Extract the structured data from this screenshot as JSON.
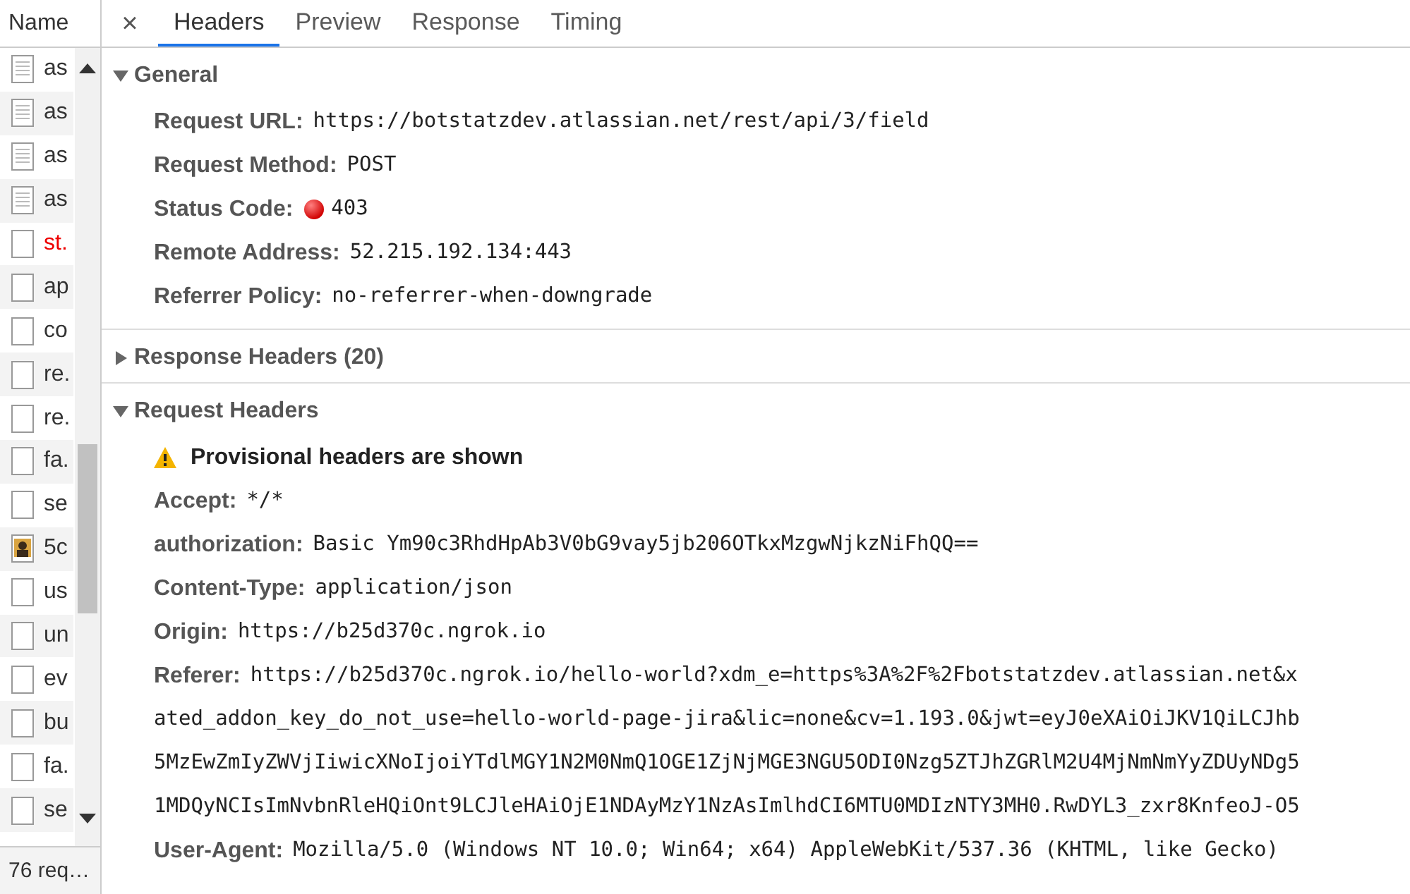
{
  "sidebar": {
    "header": "Name",
    "items": [
      {
        "name": "as",
        "kind": "document",
        "error": false
      },
      {
        "name": "as",
        "kind": "document",
        "error": false
      },
      {
        "name": "as",
        "kind": "document",
        "error": false
      },
      {
        "name": "as",
        "kind": "document",
        "error": false
      },
      {
        "name": "st.",
        "kind": "blank",
        "error": true
      },
      {
        "name": "ap",
        "kind": "blank",
        "error": false
      },
      {
        "name": "co",
        "kind": "blank",
        "error": false
      },
      {
        "name": "re.",
        "kind": "blank",
        "error": false
      },
      {
        "name": "re.",
        "kind": "blank",
        "error": false
      },
      {
        "name": "fa.",
        "kind": "blank",
        "error": false
      },
      {
        "name": "se",
        "kind": "blank",
        "error": false
      },
      {
        "name": "5c",
        "kind": "image",
        "error": false
      },
      {
        "name": "us",
        "kind": "blank",
        "error": false
      },
      {
        "name": "un",
        "kind": "blank",
        "error": false
      },
      {
        "name": "ev",
        "kind": "blank",
        "error": false
      },
      {
        "name": "bu",
        "kind": "blank",
        "error": false
      },
      {
        "name": "fa.",
        "kind": "blank",
        "error": false
      },
      {
        "name": "se",
        "kind": "blank",
        "error": false
      }
    ],
    "footer": "76 req…"
  },
  "tabs": {
    "close": "×",
    "items": [
      {
        "label": "Headers",
        "selected": true
      },
      {
        "label": "Preview",
        "selected": false
      },
      {
        "label": "Response",
        "selected": false
      },
      {
        "label": "Timing",
        "selected": false
      }
    ]
  },
  "sections": [
    {
      "title": "General",
      "expanded": true,
      "rows": [
        {
          "key": "Request URL:",
          "value": "https://botstatzdev.atlassian.net/rest/api/3/field"
        },
        {
          "key": "Request Method:",
          "value": "POST"
        },
        {
          "key": "Status Code:",
          "value": "403",
          "kind": "status"
        },
        {
          "key": "Remote Address:",
          "value": "52.215.192.134:443"
        },
        {
          "key": "Referrer Policy:",
          "value": "no-referrer-when-downgrade"
        }
      ]
    },
    {
      "title": "Response Headers (20)",
      "expanded": false
    },
    {
      "title": "Request Headers",
      "expanded": true,
      "notice": "Provisional headers are shown",
      "rows": [
        {
          "key": "Accept:",
          "value": "*/*"
        },
        {
          "key": "authorization:",
          "value": "Basic Ym90c3RhdHpAb3V0bG9vay5jb206OTkxMzgwNjkzNiFhQQ=="
        },
        {
          "key": "Content-Type:",
          "value": "application/json"
        },
        {
          "key": "Origin:",
          "value": "https://b25d370c.ngrok.io"
        },
        {
          "key": "Referer:",
          "lines": [
            "https://b25d370c.ngrok.io/hello-world?xdm_e=https%3A%2F%2Fbotstatzdev.atlassian.net&x",
            "ated_addon_key_do_not_use=hello-world-page-jira&lic=none&cv=1.193.0&jwt=eyJ0eXAiOiJKV1QiLCJhb",
            "5MzEwZmIyZWVjIiwicXNoIjoiYTdlMGY1N2M0NmQ1OGE1ZjNjMGE3NGU5ODI0Nzg5ZTJhZGRlM2U4MjNmNmYyZDUyNDg5",
            "1MDQyNCIsImNvbnRleHQiOnt9LCJleHAiOjE1NDAyMzY1NzAsImlhdCI6MTU0MDIzNTY3MH0.RwDYL3_zxr8KnfeoJ-O5"
          ]
        },
        {
          "key": "User-Agent:",
          "value": "Mozilla/5.0 (Windows NT 10.0; Win64; x64) AppleWebKit/537.36 (KHTML, like Gecko)"
        }
      ]
    }
  ]
}
